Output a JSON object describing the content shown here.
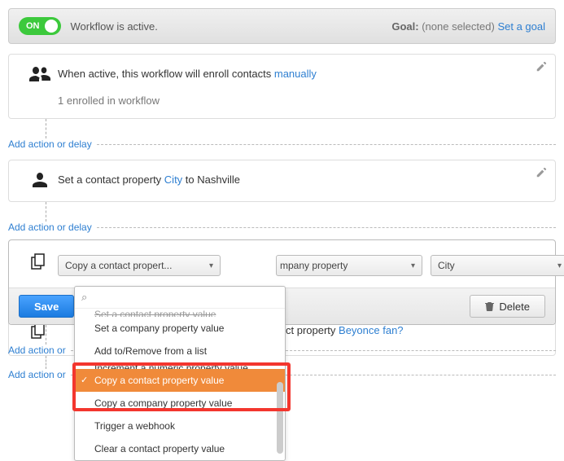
{
  "status_bar": {
    "toggle_label": "ON",
    "active_text": "Workflow is active.",
    "goal_label": "Goal:",
    "goal_value": "(none selected)",
    "goal_link": "Set a goal"
  },
  "enroll_step": {
    "text_prefix": "When active, this workflow will enroll contacts ",
    "enroll_mode": "manually",
    "enrolled_text": "1 enrolled in workflow"
  },
  "add_action_label": "Add action or delay",
  "add_action_label_truncated": "Add action or",
  "set_property_step": {
    "text_prefix": "Set a contact property ",
    "property_link": "City",
    "text_mid": " to ",
    "property_value": "Nashville"
  },
  "editor": {
    "action_select": "Copy a contact propert...",
    "target_select_partial": "mpany property",
    "value_select": "City",
    "search_placeholder": "",
    "dropdown_items": {
      "truncated": "Set a contact property value",
      "set_company": "Set a company property value",
      "add_remove": "Add to/Remove from a list",
      "increment_truncated": "Increment a numeric property value",
      "copy_contact": "Copy a contact property value",
      "copy_company": "Copy a company property value",
      "trigger_webhook": "Trigger a webhook",
      "clear_contact": "Clear a contact property value"
    },
    "save_label": "Save",
    "delete_label": "Delete"
  },
  "peek_step": {
    "visible_text": "ct property ",
    "link": "Beyonce fan?"
  },
  "icons": {
    "search": "⌕",
    "trash": "🗑",
    "pencil": "✎",
    "caret": "▾"
  }
}
